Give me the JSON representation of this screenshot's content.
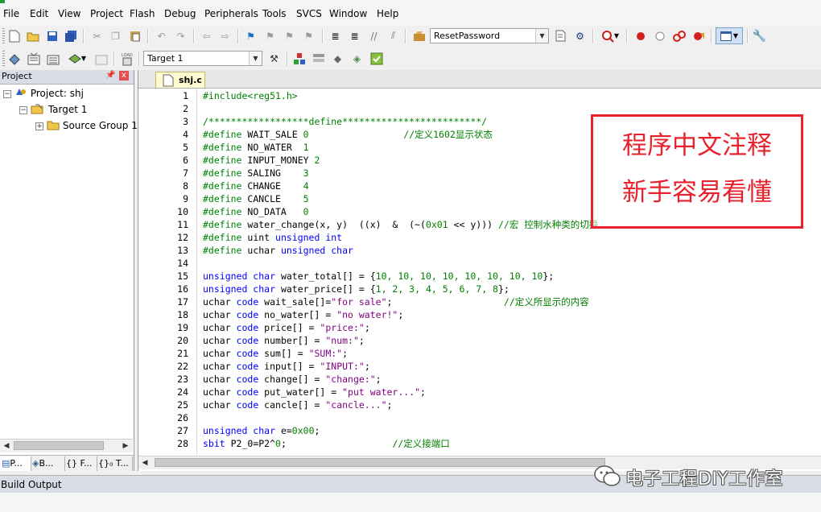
{
  "menu": [
    "File",
    "Edit",
    "View",
    "Project",
    "Flash",
    "Debug",
    "Peripherals",
    "Tools",
    "SVCS",
    "Window",
    "Help"
  ],
  "toolbar": {
    "find_combo_value": "ResetPassword",
    "target_combo_value": "Target 1"
  },
  "project_pane": {
    "title": "Project",
    "pin": "ᵖ",
    "close": "x",
    "tree": [
      {
        "label": "Project: shj",
        "icon": "project-icon"
      },
      {
        "label": "Target 1",
        "icon": "target-icon"
      },
      {
        "label": "Source Group 1",
        "icon": "folder-icon"
      }
    ],
    "tabs": [
      "P...",
      "B...",
      "{} F...",
      "{}₀ T..."
    ]
  },
  "editor": {
    "file_tab": "shj.c",
    "line_numbers": [
      "1",
      "2",
      "3",
      "4",
      "5",
      "6",
      "7",
      "8",
      "9",
      "10",
      "11",
      "12",
      "13",
      "14",
      "15",
      "16",
      "17",
      "18",
      "19",
      "20",
      "21",
      "22",
      "23",
      "24",
      "25",
      "26",
      "27",
      "28"
    ],
    "lines": [
      [
        {
          "t": "#include<reg51.h>",
          "c": "cm"
        }
      ],
      [
        {
          "t": "",
          "c": ""
        }
      ],
      [
        {
          "t": "/******************define*************************/",
          "c": "cm"
        }
      ],
      [
        {
          "t": "#define ",
          "c": "cm"
        },
        {
          "t": "WAIT_SALE ",
          "c": ""
        },
        {
          "t": "0",
          "c": "cm"
        },
        {
          "t": "                 //定义1602显示状态",
          "c": "cm"
        }
      ],
      [
        {
          "t": "#define ",
          "c": "cm"
        },
        {
          "t": "NO_WATER  ",
          "c": ""
        },
        {
          "t": "1",
          "c": "cm"
        }
      ],
      [
        {
          "t": "#define ",
          "c": "cm"
        },
        {
          "t": "INPUT_MONEY ",
          "c": ""
        },
        {
          "t": "2",
          "c": "cm"
        }
      ],
      [
        {
          "t": "#define ",
          "c": "cm"
        },
        {
          "t": "SALING    ",
          "c": ""
        },
        {
          "t": "3",
          "c": "cm"
        }
      ],
      [
        {
          "t": "#define ",
          "c": "cm"
        },
        {
          "t": "CHANGE    ",
          "c": ""
        },
        {
          "t": "4",
          "c": "cm"
        }
      ],
      [
        {
          "t": "#define ",
          "c": "cm"
        },
        {
          "t": "CANCLE    ",
          "c": ""
        },
        {
          "t": "5",
          "c": "cm"
        }
      ],
      [
        {
          "t": "#define ",
          "c": "cm"
        },
        {
          "t": "NO_DATA   ",
          "c": ""
        },
        {
          "t": "0",
          "c": "cm"
        }
      ],
      [
        {
          "t": "#define ",
          "c": "cm"
        },
        {
          "t": "water_change(x, y)  ((x)  &  (~(",
          "c": ""
        },
        {
          "t": "0x01",
          "c": "cm"
        },
        {
          "t": " << y))) ",
          "c": ""
        },
        {
          "t": "//宏 控制水种类的切换",
          "c": "cm"
        }
      ],
      [
        {
          "t": "#define ",
          "c": "cm"
        },
        {
          "t": "uint ",
          "c": ""
        },
        {
          "t": "unsigned int",
          "c": "kw"
        }
      ],
      [
        {
          "t": "#define ",
          "c": "cm"
        },
        {
          "t": "uchar ",
          "c": ""
        },
        {
          "t": "unsigned char",
          "c": "kw"
        }
      ],
      [
        {
          "t": "",
          "c": ""
        }
      ],
      [
        {
          "t": "unsigned char",
          "c": "kw"
        },
        {
          "t": " water_total[] = {",
          "c": ""
        },
        {
          "t": "10, 10, 10, 10, 10, 10, 10, 10",
          "c": "cm"
        },
        {
          "t": "};",
          "c": ""
        }
      ],
      [
        {
          "t": "unsigned char",
          "c": "kw"
        },
        {
          "t": " water_price[] = {",
          "c": ""
        },
        {
          "t": "1, 2, 3, 4, 5, 6, 7, 8",
          "c": "cm"
        },
        {
          "t": "};",
          "c": ""
        }
      ],
      [
        {
          "t": "uchar ",
          "c": ""
        },
        {
          "t": "code",
          "c": "kw"
        },
        {
          "t": " wait_sale[]=",
          "c": ""
        },
        {
          "t": "\"for sale\"",
          "c": "st"
        },
        {
          "t": ";                    ",
          "c": ""
        },
        {
          "t": "//定义所显示的内容",
          "c": "cm"
        }
      ],
      [
        {
          "t": "uchar ",
          "c": ""
        },
        {
          "t": "code",
          "c": "kw"
        },
        {
          "t": " no_water[] = ",
          "c": ""
        },
        {
          "t": "\"no water!\"",
          "c": "st"
        },
        {
          "t": ";",
          "c": ""
        }
      ],
      [
        {
          "t": "uchar ",
          "c": ""
        },
        {
          "t": "code",
          "c": "kw"
        },
        {
          "t": " price[] = ",
          "c": ""
        },
        {
          "t": "\"price:\"",
          "c": "st"
        },
        {
          "t": ";",
          "c": ""
        }
      ],
      [
        {
          "t": "uchar ",
          "c": ""
        },
        {
          "t": "code",
          "c": "kw"
        },
        {
          "t": " number[] = ",
          "c": ""
        },
        {
          "t": "\"num:\"",
          "c": "st"
        },
        {
          "t": ";",
          "c": ""
        }
      ],
      [
        {
          "t": "uchar ",
          "c": ""
        },
        {
          "t": "code",
          "c": "kw"
        },
        {
          "t": " sum[] = ",
          "c": ""
        },
        {
          "t": "\"SUM:\"",
          "c": "st"
        },
        {
          "t": ";",
          "c": ""
        }
      ],
      [
        {
          "t": "uchar ",
          "c": ""
        },
        {
          "t": "code",
          "c": "kw"
        },
        {
          "t": " input[] = ",
          "c": ""
        },
        {
          "t": "\"INPUT:\"",
          "c": "st"
        },
        {
          "t": ";",
          "c": ""
        }
      ],
      [
        {
          "t": "uchar ",
          "c": ""
        },
        {
          "t": "code",
          "c": "kw"
        },
        {
          "t": " change[] = ",
          "c": ""
        },
        {
          "t": "\"change:\"",
          "c": "st"
        },
        {
          "t": ";",
          "c": ""
        }
      ],
      [
        {
          "t": "uchar ",
          "c": ""
        },
        {
          "t": "code",
          "c": "kw"
        },
        {
          "t": " put_water[] = ",
          "c": ""
        },
        {
          "t": "\"put water...\"",
          "c": "st"
        },
        {
          "t": ";",
          "c": ""
        }
      ],
      [
        {
          "t": "uchar ",
          "c": ""
        },
        {
          "t": "code",
          "c": "kw"
        },
        {
          "t": " cancle[] = ",
          "c": ""
        },
        {
          "t": "\"cancle...\"",
          "c": "st"
        },
        {
          "t": ";",
          "c": ""
        }
      ],
      [
        {
          "t": "",
          "c": ""
        }
      ],
      [
        {
          "t": "unsigned char",
          "c": "kw"
        },
        {
          "t": " e=",
          "c": ""
        },
        {
          "t": "0x00",
          "c": "cm"
        },
        {
          "t": ";",
          "c": ""
        }
      ],
      [
        {
          "t": "sbit",
          "c": "kw"
        },
        {
          "t": " P2_0=P2^",
          "c": ""
        },
        {
          "t": "0",
          "c": "cm"
        },
        {
          "t": ";                   ",
          "c": ""
        },
        {
          "t": "//定义接端口",
          "c": "cm"
        }
      ]
    ]
  },
  "annotation": {
    "line1": "程序中文注释",
    "line2": "新手容易看懂"
  },
  "build_output": {
    "title": "Build Output"
  },
  "watermark": {
    "text": "电子工程DIY工作室"
  },
  "colors": {
    "keyword": "#0000ff",
    "comment": "#008000",
    "string": "#7f007f",
    "annotation": "#e8222c"
  }
}
